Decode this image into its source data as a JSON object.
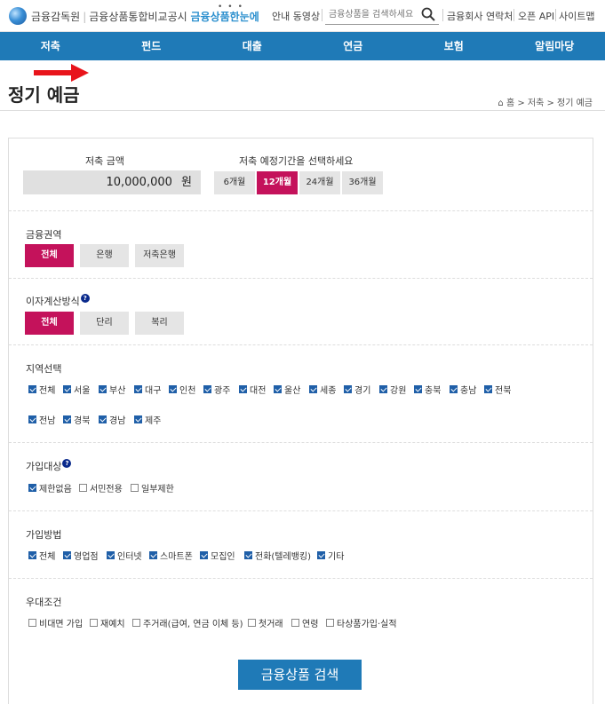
{
  "header": {
    "brand_fss": "금융감독원",
    "brand_compare": "금융상품통합비교공시",
    "brand_service": "금융상품한눈에",
    "guide_video": "안내 동영상",
    "search_placeholder": "금융상품을 검색하세요",
    "contact": "금융회사 연락처",
    "open_api": "오픈 API",
    "sitemap": "사이트맵"
  },
  "nav": [
    "저축",
    "펀드",
    "대출",
    "연금",
    "보험",
    "알림마당"
  ],
  "page": {
    "title": "정기 예금",
    "breadcrumb": "홈 > 저축 > 정기 예금"
  },
  "amount": {
    "label": "저축 금액",
    "value": "10,000,000",
    "unit": "원"
  },
  "period": {
    "label": "저축 예정기간을 선택하세요",
    "options": [
      "6개월",
      "12개월",
      "24개월",
      "36개월"
    ],
    "selected": "12개월"
  },
  "sector": {
    "label": "금융권역",
    "options": [
      "전체",
      "은행",
      "저축은행"
    ],
    "selected": "전체"
  },
  "interest": {
    "label": "이자계산방식",
    "options": [
      "전체",
      "단리",
      "복리"
    ],
    "selected": "전체"
  },
  "region": {
    "label": "지역선택",
    "row1": [
      "전체",
      "서울",
      "부산",
      "대구",
      "인천",
      "광주",
      "대전",
      "울산",
      "세종",
      "경기",
      "강원",
      "충북",
      "충남",
      "전북"
    ],
    "row2": [
      "전남",
      "경북",
      "경남",
      "제주"
    ]
  },
  "target": {
    "label": "가입대상",
    "options": [
      "제한없음",
      "서민전용",
      "일부제한"
    ],
    "checked": [
      true,
      false,
      false
    ]
  },
  "method": {
    "label": "가입방법",
    "options": [
      "전체",
      "영업점",
      "인터넷",
      "스마트폰",
      "모집인",
      "전화(텔레뱅킹)",
      "기타"
    ]
  },
  "benefit": {
    "label": "우대조건",
    "options": [
      "비대면 가입",
      "재예치",
      "주거래(급여, 연금 이체 등)",
      "첫거래",
      "연령",
      "타상품가입·실적"
    ]
  },
  "search_button": "금융상품 검색",
  "colors": {
    "nav": "#1f7ab7",
    "selected": "#c4125b",
    "checkbox": "#1f5fa8",
    "arrow": "#e8141b"
  }
}
